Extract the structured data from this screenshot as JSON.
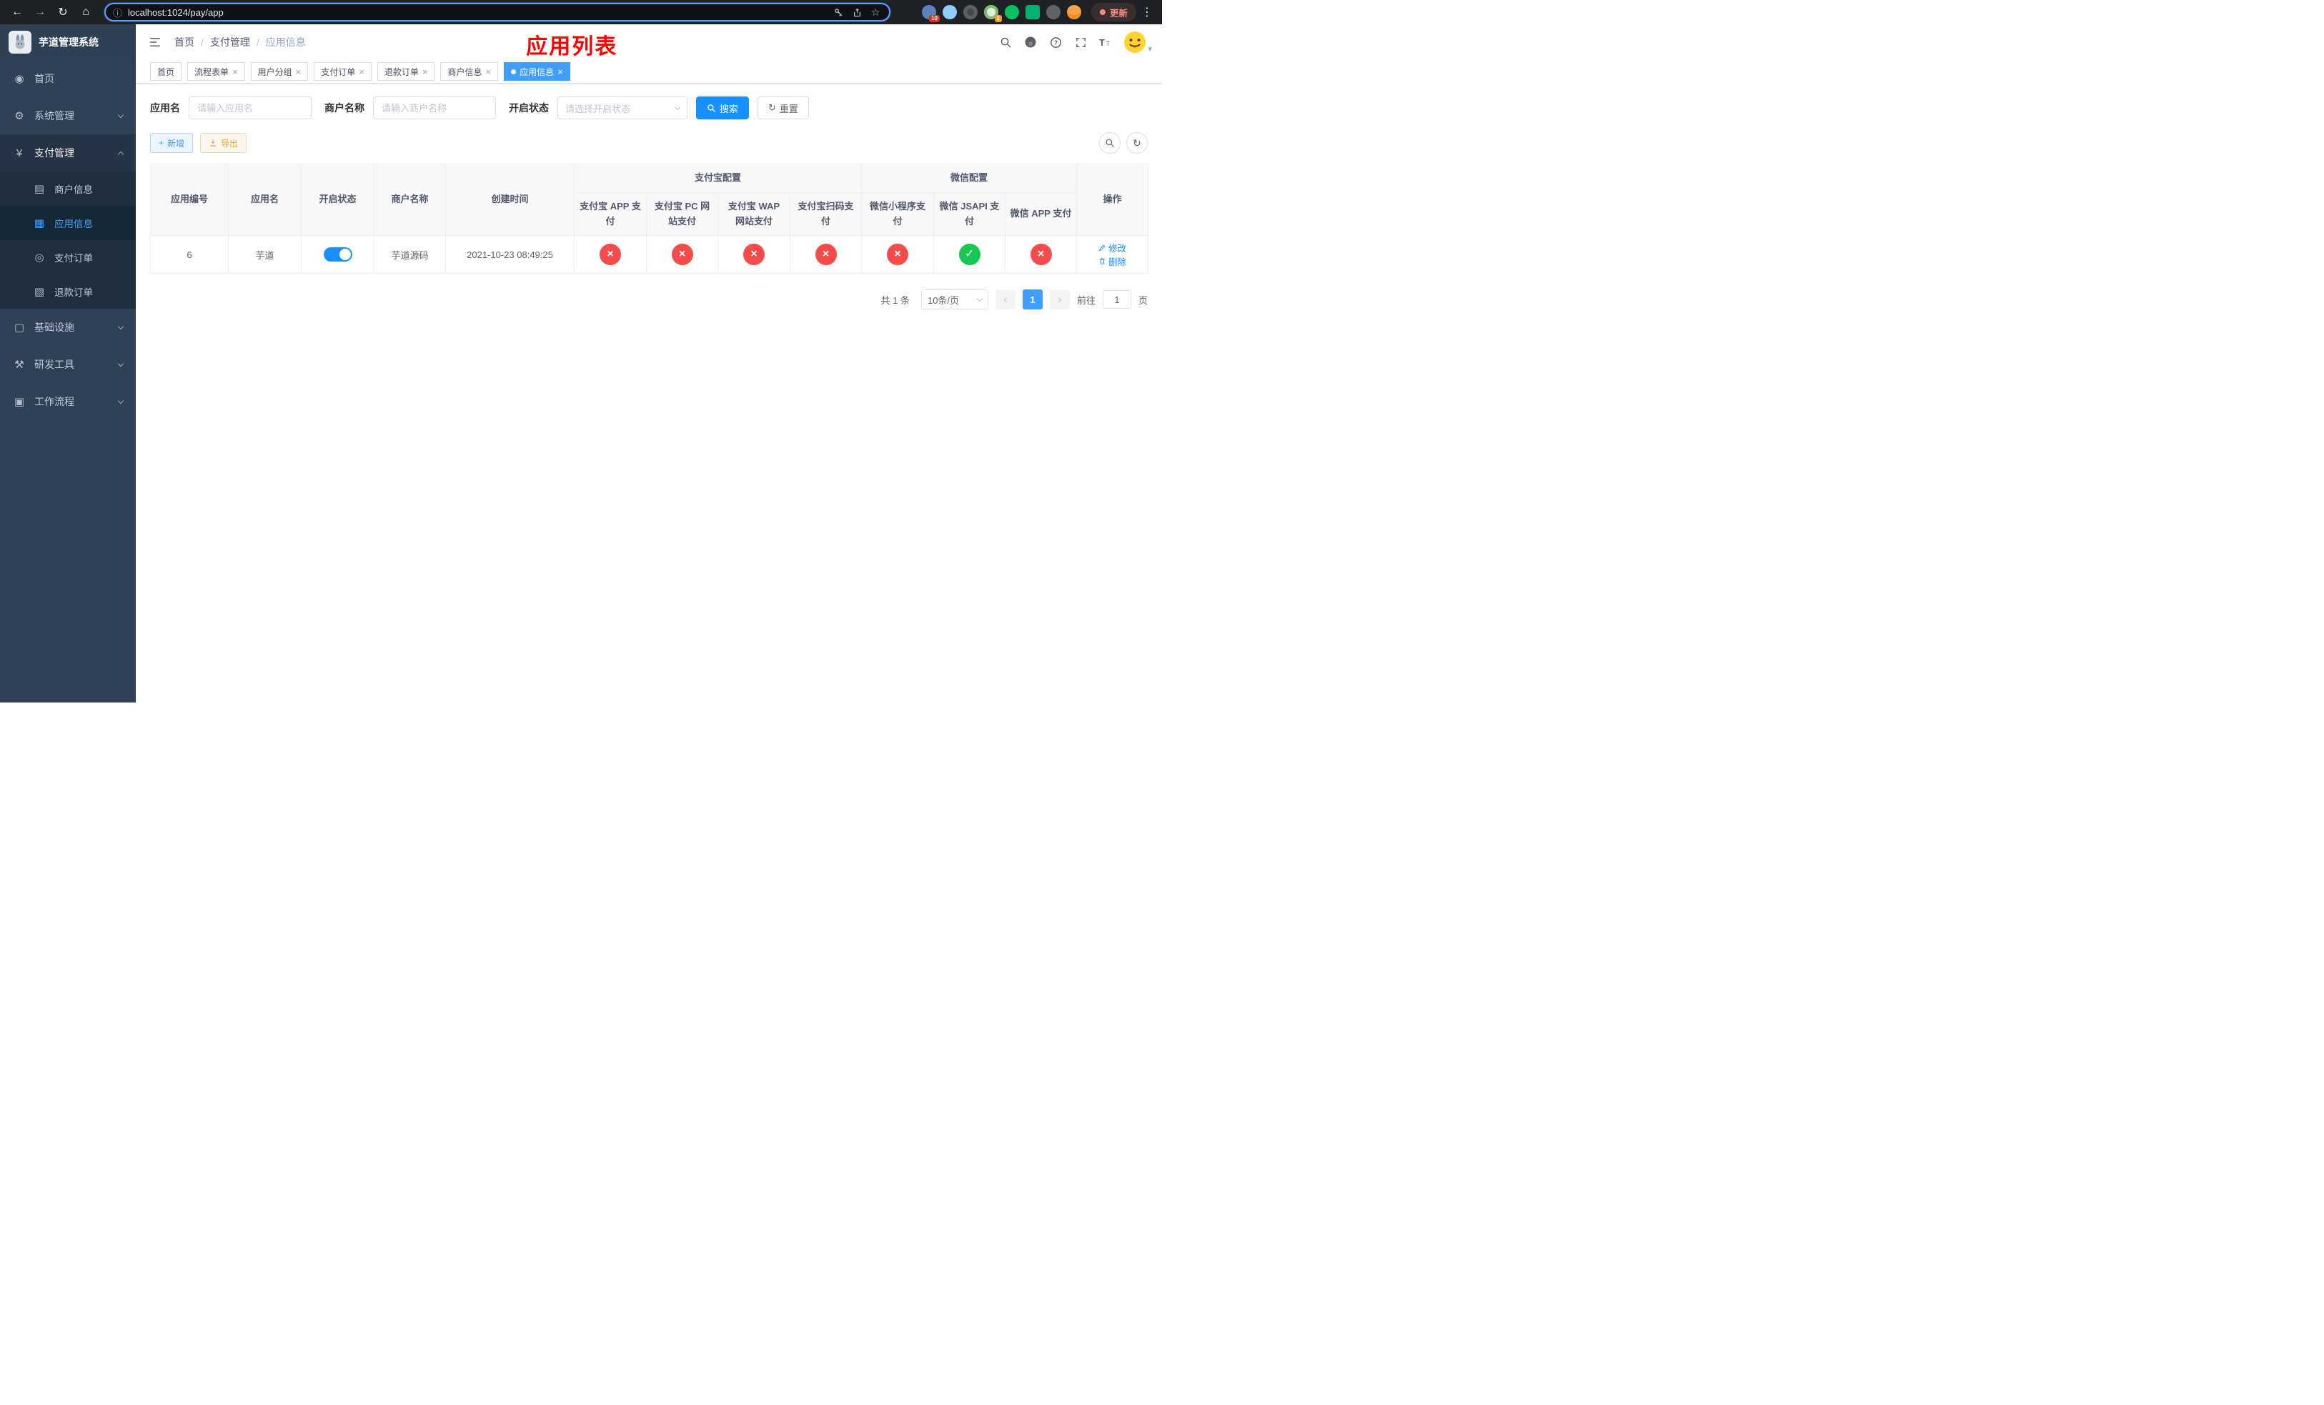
{
  "colors": {
    "accent": "#409eff",
    "primary_button": "#1890ff",
    "danger": "#f54b4b",
    "success": "#17c653",
    "title_red": "#ff0000",
    "sidebar_bg": "#304156"
  },
  "icons": {
    "back": "←",
    "forward": "→",
    "reload": "↻",
    "home": "⌂",
    "info": "ⓘ",
    "star": "☆",
    "menu_dots": "⋮",
    "dashboard": "◉",
    "gear": "⚙",
    "yen": "¥",
    "card": "▤",
    "grid": "▦",
    "order": "◎",
    "refund": "▧",
    "infra": "▢",
    "tools": "⚒",
    "workflow": "▣",
    "plus": "+",
    "refresh": "↻",
    "close": "×",
    "check": "✓",
    "cross": "×",
    "prev": "‹",
    "next": "›",
    "caret_down": "▾"
  },
  "browser": {
    "url": "localhost:1024/pay/app",
    "update_label": "更新",
    "extension_badge_1": "10",
    "extension_badge_2": "1"
  },
  "sidebar": {
    "logo_title": "芋道管理系统",
    "items": [
      {
        "label": "首页"
      },
      {
        "label": "系统管理"
      },
      {
        "label": "支付管理"
      },
      {
        "label": "基础设施"
      },
      {
        "label": "研发工具"
      },
      {
        "label": "工作流程"
      }
    ],
    "submenu": [
      {
        "label": "商户信息"
      },
      {
        "label": "应用信息"
      },
      {
        "label": "支付订单"
      },
      {
        "label": "退款订单"
      }
    ]
  },
  "header": {
    "breadcrumb": [
      "首页",
      "支付管理",
      "应用信息"
    ],
    "breadcrumb_sep": "/",
    "page_title": "应用列表"
  },
  "tabs": [
    {
      "label": "首页",
      "closable": false,
      "active": false
    },
    {
      "label": "流程表单",
      "closable": true,
      "active": false
    },
    {
      "label": "用户分组",
      "closable": true,
      "active": false
    },
    {
      "label": "支付订单",
      "closable": true,
      "active": false
    },
    {
      "label": "退款订单",
      "closable": true,
      "active": false
    },
    {
      "label": "商户信息",
      "closable": true,
      "active": false
    },
    {
      "label": "应用信息",
      "closable": true,
      "active": true
    }
  ],
  "filters": {
    "app_name_label": "应用名",
    "app_name_placeholder": "请输入应用名",
    "merchant_label": "商户名称",
    "merchant_placeholder": "请输入商户名称",
    "status_label": "开启状态",
    "status_placeholder": "请选择开启状态",
    "search_label": "搜索",
    "reset_label": "重置"
  },
  "toolbar": {
    "add_label": "新增",
    "export_label": "导出"
  },
  "table": {
    "groups": {
      "alipay": "支付宝配置",
      "wechat": "微信配置"
    },
    "columns": {
      "id": "应用编号",
      "name": "应用名",
      "status": "开启状态",
      "merchant": "商户名称",
      "created": "创建时间",
      "alipay_app": "支付宝 APP 支付",
      "alipay_pc": "支付宝 PC 网站支付",
      "alipay_wap": "支付宝 WAP 网站支付",
      "alipay_qr": "支付宝扫码支付",
      "wx_mini": "微信小程序支付",
      "wx_jsapi": "微信 JSAPI 支付",
      "wx_app": "微信 APP 支付",
      "actions": "操作"
    },
    "row": {
      "id": "6",
      "name": "芋道",
      "enabled": true,
      "merchant": "芋道源码",
      "created": "2021-10-23 08:49:25",
      "config_status": [
        false,
        false,
        false,
        false,
        false,
        true,
        false
      ],
      "edit_label": "修改",
      "delete_label": "删除"
    }
  },
  "pagination": {
    "total": "共 1 条",
    "page_size": "10条/页",
    "page": "1",
    "goto_label": "前往",
    "goto_value": "1",
    "unit": "页"
  }
}
